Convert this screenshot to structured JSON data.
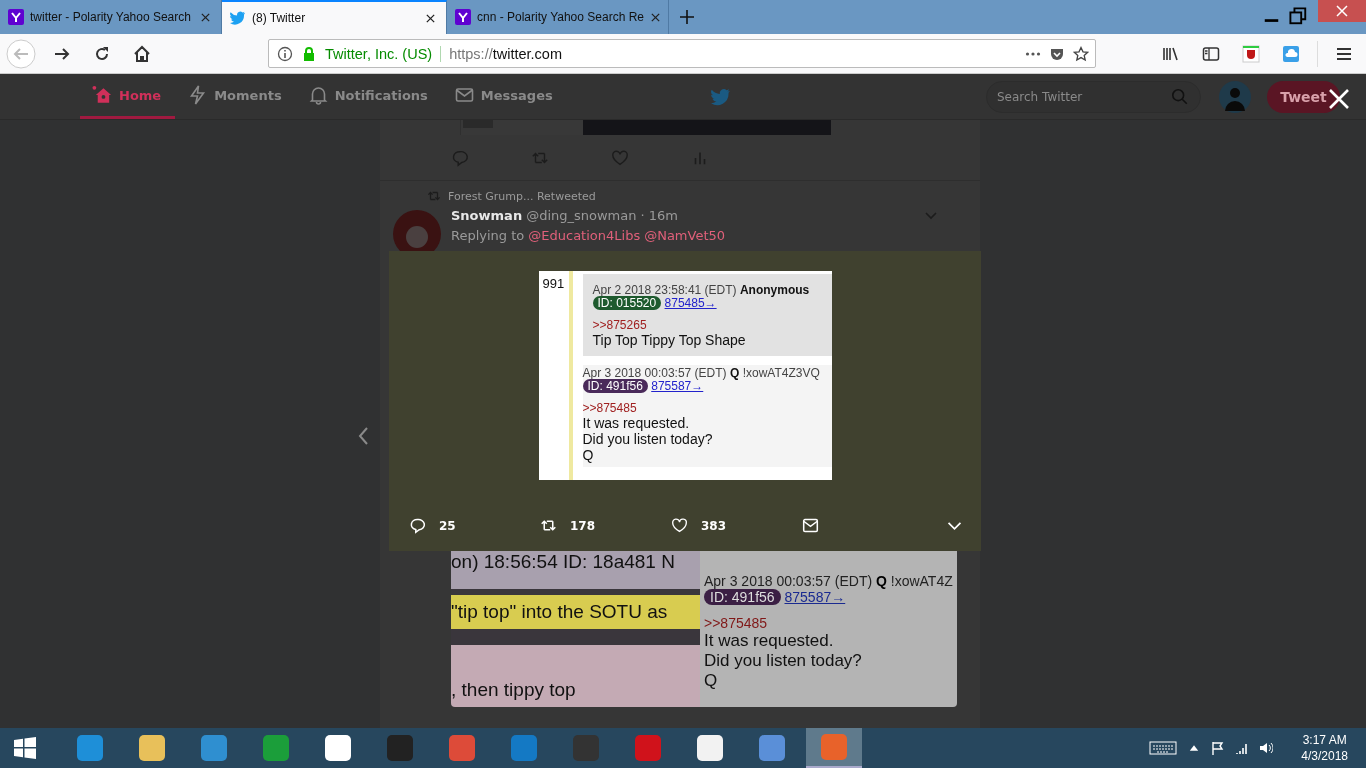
{
  "browser": {
    "tabs": [
      {
        "title": "twitter - Polarity Yahoo Search",
        "kind": "yahoo",
        "selected": false
      },
      {
        "title": "(8) Twitter",
        "kind": "bird",
        "selected": true
      },
      {
        "title": "cnn - Polarity Yahoo Search Re",
        "kind": "yahoo",
        "selected": false
      }
    ],
    "address": {
      "identity": "Twitter, Inc. (US)",
      "url_prefix": "https://",
      "url_host": "twitter.com"
    }
  },
  "twitter_nav": {
    "items": [
      {
        "label": "Home",
        "kind": "home",
        "selected": true
      },
      {
        "label": "Moments",
        "kind": "bolt",
        "selected": false
      },
      {
        "label": "Notifications",
        "kind": "bell",
        "selected": false
      },
      {
        "label": "Messages",
        "kind": "mail",
        "selected": false
      }
    ],
    "search": {
      "placeholder": "Search Twitter"
    },
    "tweet_button": "Tweet"
  },
  "timeline": {
    "retweet_note": "Forest Grump... Retweeted",
    "author": "Snowman",
    "handle": "@ding_snowman",
    "time": "· 16m",
    "replying_label": "Replying to",
    "mentions": [
      "@Education4Libs",
      "@NamVet50"
    ],
    "image": {
      "left_lines": [
        {
          "text": "on) 18:56:54 ID: 18a481 N",
          "highlighted": false
        },
        {
          "text": "\"tip top\" into the SOTU as",
          "highlighted": true
        },
        {
          "text": ", then tippy top",
          "highlighted": false
        }
      ],
      "post": {
        "meta": "Apr 3 2018 00:03:57 (EDT)",
        "author": "Q",
        "trip": "!xowAT4Z",
        "id": "ID: 491f56",
        "color": "#3b1f44",
        "link": "875587→",
        "quote": ">>875485",
        "lines": [
          "It was requested.",
          "Did you listen today?",
          "Q"
        ]
      }
    }
  },
  "modal": {
    "image": {
      "post_number": "991",
      "posts": [
        {
          "meta": "Apr 2 2018 23:58:41 (EDT)",
          "author": "Anonymous",
          "id": "ID: 015520",
          "color": "#1e5a2e",
          "link": "875485→",
          "quote": ">>875265",
          "lines": [
            "Tip Top Tippy Top Shape"
          ],
          "highlighted": true
        },
        {
          "meta": "Apr 3 2018 00:03:57 (EDT)",
          "author": "Q",
          "trip": "!xowAT4Z3VQ",
          "id": "ID: 491f56",
          "color": "#4a2a5a",
          "link": "875587→",
          "quote": ">>875485",
          "lines": [
            "It was requested.",
            "Did you listen today?",
            "Q"
          ],
          "highlighted": false
        }
      ]
    },
    "actions": [
      {
        "kind": "reply",
        "count": "25"
      },
      {
        "kind": "retweet",
        "count": "178"
      },
      {
        "kind": "like",
        "count": "383"
      },
      {
        "kind": "message"
      }
    ]
  },
  "taskbar": {
    "apps": [
      {
        "kind": "ie",
        "active": false
      },
      {
        "kind": "folder",
        "active": false
      },
      {
        "kind": "ship",
        "active": false
      },
      {
        "kind": "store",
        "active": false
      },
      {
        "kind": "box",
        "active": false
      },
      {
        "kind": "amazon",
        "active": false
      },
      {
        "kind": "chrome",
        "active": false
      },
      {
        "kind": "cloud",
        "active": false
      },
      {
        "kind": "puzzle",
        "active": false
      },
      {
        "kind": "opera",
        "active": false
      },
      {
        "kind": "file",
        "active": false
      },
      {
        "kind": "chromium",
        "active": false
      },
      {
        "kind": "firefox",
        "active": true
      }
    ],
    "time": "3:17 AM",
    "date": "4/3/2018"
  }
}
